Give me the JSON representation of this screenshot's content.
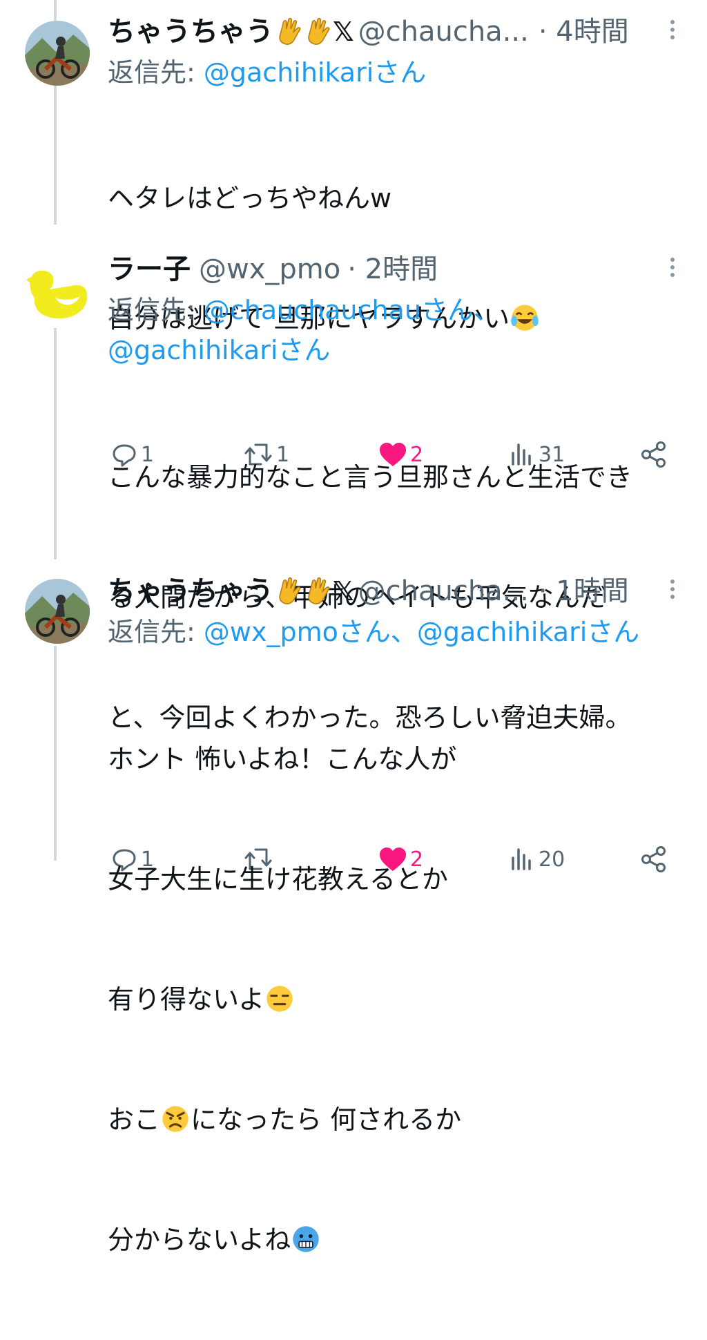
{
  "tweets": [
    {
      "name": "ちゃうちゃう",
      "handle": "@chaucha...",
      "time": "· 4時間",
      "reply_prefix": "返信先: ",
      "reply_to_1": "@gachihikariさん",
      "text_1": "ヘタレはどっちやねんw",
      "text_2": "自分は逃げて 旦那にヤラすんかい",
      "replies": "1",
      "retweets": "1",
      "likes": "2",
      "views": "31"
    },
    {
      "name": "ラー子",
      "handle": "@wx_pmo",
      "time": "· 2時間",
      "reply_prefix": "返信先: ",
      "reply_to_1": "@chauchauchauさん、",
      "reply_to_2": "@gachihikariさん",
      "text_1": "こんな暴力的なこと言う旦那さんと生活でき",
      "text_2": "る人間だから、甲姉のヘイトも平気なんだ",
      "text_3": "と、今回よくわかった。恐ろしい脅迫夫婦。",
      "replies": "1",
      "retweets": "",
      "likes": "2",
      "views": "20"
    },
    {
      "name": "ちゃうちゃう",
      "handle": "@chaucha...",
      "time": "· 1時間",
      "reply_prefix": "返信先: ",
      "reply_to_1": "@wx_pmoさん、",
      "reply_to_2": "@gachihikariさん",
      "text_1": "ホント 怖いよね！こんな人が",
      "text_2": "女子大生に生け花教えるとか",
      "text_3": "有り得ないよ",
      "text_4a": "おこ",
      "text_4b": "になったら 何されるか",
      "text_5": "分からないよね"
    }
  ],
  "icons": {
    "waving_hand": "waving-hand-emoji",
    "x_logo": "𝕏",
    "laugh": "tears-of-joy-emoji",
    "expressionless": "expressionless-emoji",
    "angry": "angry-emoji",
    "cold": "cold-face-emoji"
  },
  "colors": {
    "link": "#1d9bf0",
    "like": "#f91880",
    "meta": "#536471",
    "thread": "#cfd9de"
  }
}
